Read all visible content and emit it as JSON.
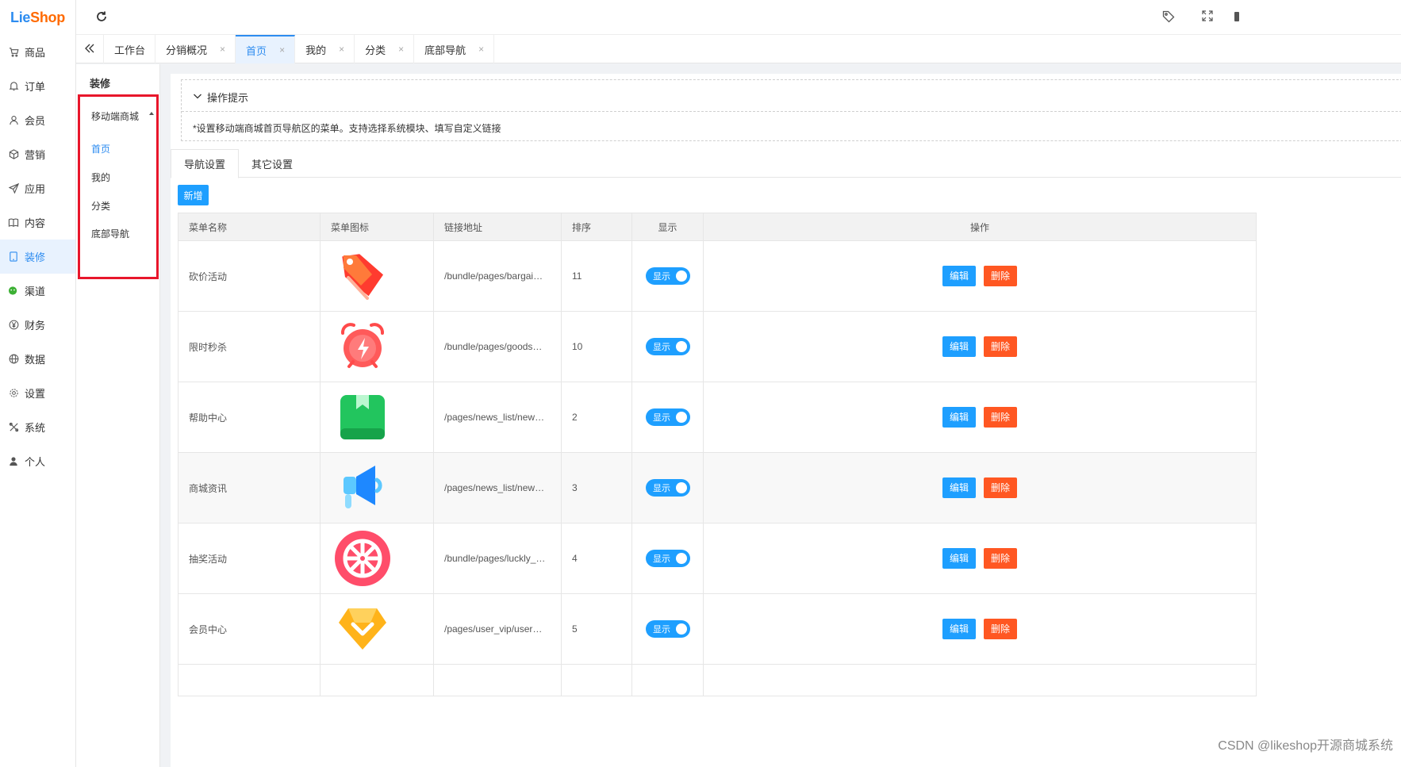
{
  "app": {
    "logo_part1": "Lie",
    "logo_part2": "Shop"
  },
  "sidebar": {
    "items": [
      {
        "label": "商品",
        "icon": "cart-icon"
      },
      {
        "label": "订单",
        "icon": "bell-icon"
      },
      {
        "label": "会员",
        "icon": "user-icon"
      },
      {
        "label": "营销",
        "icon": "box-icon"
      },
      {
        "label": "应用",
        "icon": "send-icon"
      },
      {
        "label": "内容",
        "icon": "book-icon"
      },
      {
        "label": "装修",
        "icon": "tablet-icon",
        "active": true
      },
      {
        "label": "渠道",
        "icon": "wechat-icon"
      },
      {
        "label": "财务",
        "icon": "yen-icon"
      },
      {
        "label": "数据",
        "icon": "globe-icon"
      },
      {
        "label": "设置",
        "icon": "gear-icon"
      },
      {
        "label": "系统",
        "icon": "tools-icon"
      },
      {
        "label": "个人",
        "icon": "person-icon"
      }
    ]
  },
  "tabs": [
    {
      "label": "工作台",
      "closable": false
    },
    {
      "label": "分销概况",
      "closable": true
    },
    {
      "label": "首页",
      "closable": true,
      "active": true
    },
    {
      "label": "我的",
      "closable": true
    },
    {
      "label": "分类",
      "closable": true
    },
    {
      "label": "底部导航",
      "closable": true
    }
  ],
  "tab_close_glyph": "×",
  "subnav": {
    "title": "装修",
    "group": "移动端商城",
    "items": [
      "首页",
      "我的",
      "分类",
      "底部导航"
    ]
  },
  "tips": {
    "title": "操作提示",
    "text": "*设置移动端商城首页导航区的菜单。支持选择系统模块、填写自定义链接"
  },
  "content_tabs": [
    "导航设置",
    "其它设置"
  ],
  "add_label": "新增",
  "table": {
    "headers": [
      "菜单名称",
      "菜单图标",
      "链接地址",
      "排序",
      "显示",
      "操作"
    ],
    "rows": [
      {
        "name": "砍价活动",
        "icon": "price-tag-icon",
        "link": "/bundle/pages/bargai…",
        "sort": "11",
        "show": "显示"
      },
      {
        "name": "限时秒杀",
        "icon": "alarm-clock-icon",
        "link": "/bundle/pages/goods…",
        "sort": "10",
        "show": "显示"
      },
      {
        "name": "帮助中心",
        "icon": "bookmark-book-icon",
        "link": "/pages/news_list/new…",
        "sort": "2",
        "show": "显示"
      },
      {
        "name": "商城资讯",
        "icon": "megaphone-icon",
        "link": "/pages/news_list/new…",
        "sort": "3",
        "show": "显示"
      },
      {
        "name": "抽奖活动",
        "icon": "lucky-wheel-icon",
        "link": "/bundle/pages/luckly_…",
        "sort": "4",
        "show": "显示"
      },
      {
        "name": "会员中心",
        "icon": "vip-diamond-icon",
        "link": "/pages/user_vip/user…",
        "sort": "5",
        "show": "显示"
      }
    ],
    "edit_label": "编辑",
    "delete_label": "删除"
  },
  "colors": {
    "primary": "#1e9fff",
    "danger": "#ff5722",
    "highlight_box": "#e8162b",
    "active_nav": "#2d8cf0"
  },
  "watermark": "CSDN @likeshop开源商城系统"
}
